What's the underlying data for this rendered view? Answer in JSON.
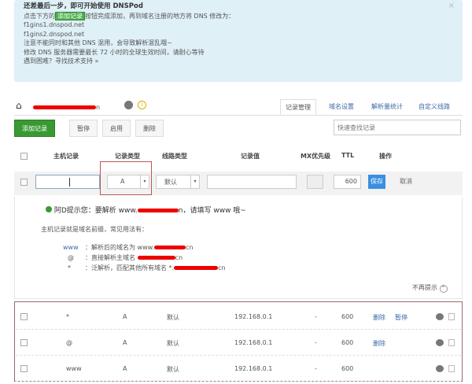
{
  "banner": {
    "title": "还差最后一步，即可开始使用 DNSPod",
    "line1_pre": "点击下方的",
    "line1_highlight": "添加记录",
    "line1_post": "按钮完成添加，再到域名注册的地方将 DNS 修改为：",
    "ns1": "f1gins1.dnspod.net",
    "ns2": "f1gins2.dnspod.net",
    "line2": "注意不能同时和其他 DNS 混用，会导致解析混乱哦~",
    "line3": "修改 DNS 服务器需要最长 72 小时的全球生效时间，请耐心等待",
    "help": "遇到困难？寻找技术支持 »",
    "close": "×"
  },
  "header": {
    "domain_suffix": "n",
    "tabs": [
      "记录管理",
      "域名设置",
      "解析量统计",
      "自定义线路"
    ]
  },
  "toolbar": {
    "add": "添加记录",
    "pause": "暂停",
    "enable": "启用",
    "delete": "删除",
    "search_placeholder": "快速查找记录"
  },
  "columns": [
    "主机记录",
    "记录类型",
    "线路类型",
    "记录值",
    "MX优先级",
    "TTL",
    "操作"
  ],
  "new_row": {
    "type": "A",
    "line": "默认",
    "ttl": "600",
    "save": "保存",
    "cancel": "取消"
  },
  "tip": {
    "title_pre": "阿D提示您：要解析 www.",
    "title_post": "n，请填写 www 哦~",
    "intro": "主机记录就是域名前缀，常见用法有：",
    "items": [
      {
        "k": "www",
        "v": "：解析后的域名为 www.",
        "s": "cn"
      },
      {
        "k": "@",
        "v": "：直接解析主域名 ",
        "s": "cn"
      },
      {
        "k": "*",
        "v": "：泛解析，匹配其他所有域名 *.",
        "s": "cn"
      }
    ],
    "dismiss": "不再提示"
  },
  "records": [
    {
      "host": "*",
      "type": "A",
      "line": "默认",
      "value": "192.168.0.1",
      "mx": "-",
      "ttl": "600",
      "a1": "删除",
      "a2": "暂停"
    },
    {
      "host": "@",
      "type": "A",
      "line": "默认",
      "value": "192.168.0.1",
      "mx": "-",
      "ttl": "600",
      "a1": "删除",
      "a2": ""
    },
    {
      "host": "www",
      "type": "A",
      "line": "默认",
      "value": "192.168.0.1",
      "mx": "-",
      "ttl": "600",
      "a1": "",
      "a2": ""
    }
  ]
}
